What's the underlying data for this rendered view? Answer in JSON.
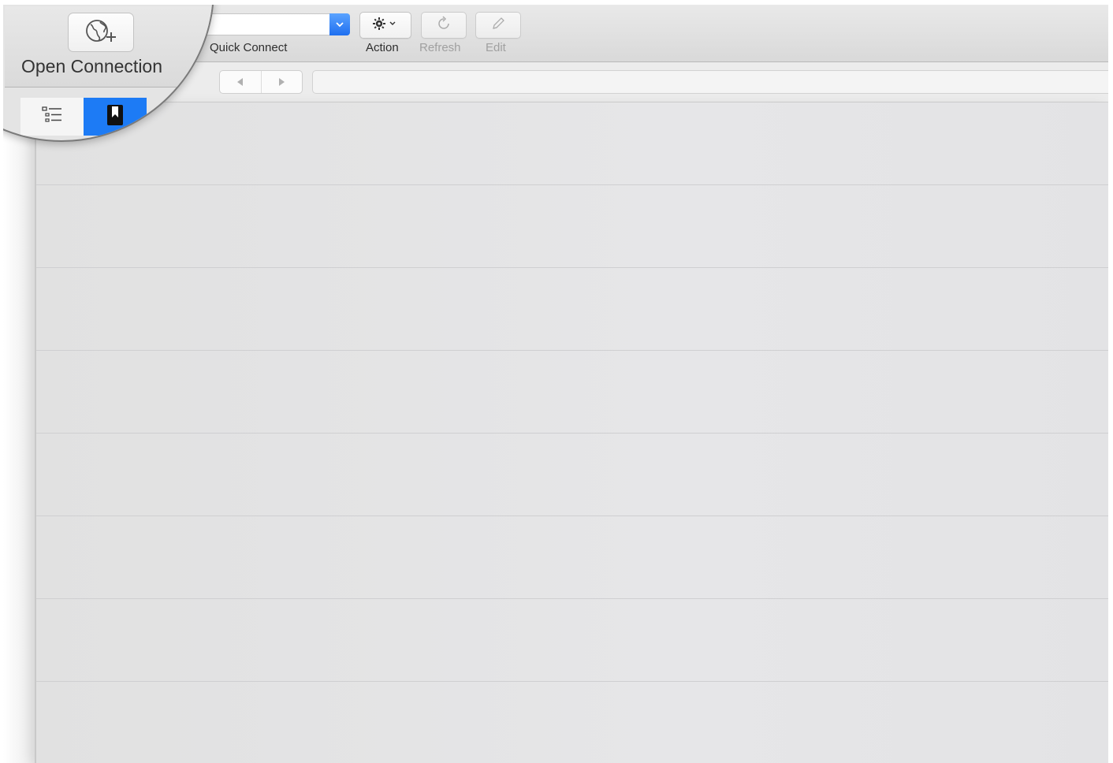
{
  "toolbar": {
    "open_connection_label": "Open Connection",
    "quick_connect_label": "Quick Connect",
    "action_label": "Action",
    "refresh_label": "Refresh",
    "edit_label": "Edit"
  },
  "navigation": {
    "back_icon": "back-arrow-icon",
    "forward_icon": "forward-arrow-icon",
    "path_value": ""
  },
  "sidebar_tabs": [
    {
      "name": "outline-view",
      "icon": "outline-list-icon",
      "active": false
    },
    {
      "name": "bookmarks-view",
      "icon": "bookmark-icon",
      "active": true
    }
  ],
  "colors": {
    "accent": "#1d7bf5",
    "combo_arrow": "#2a77f2"
  },
  "content": {
    "rows": 8
  }
}
